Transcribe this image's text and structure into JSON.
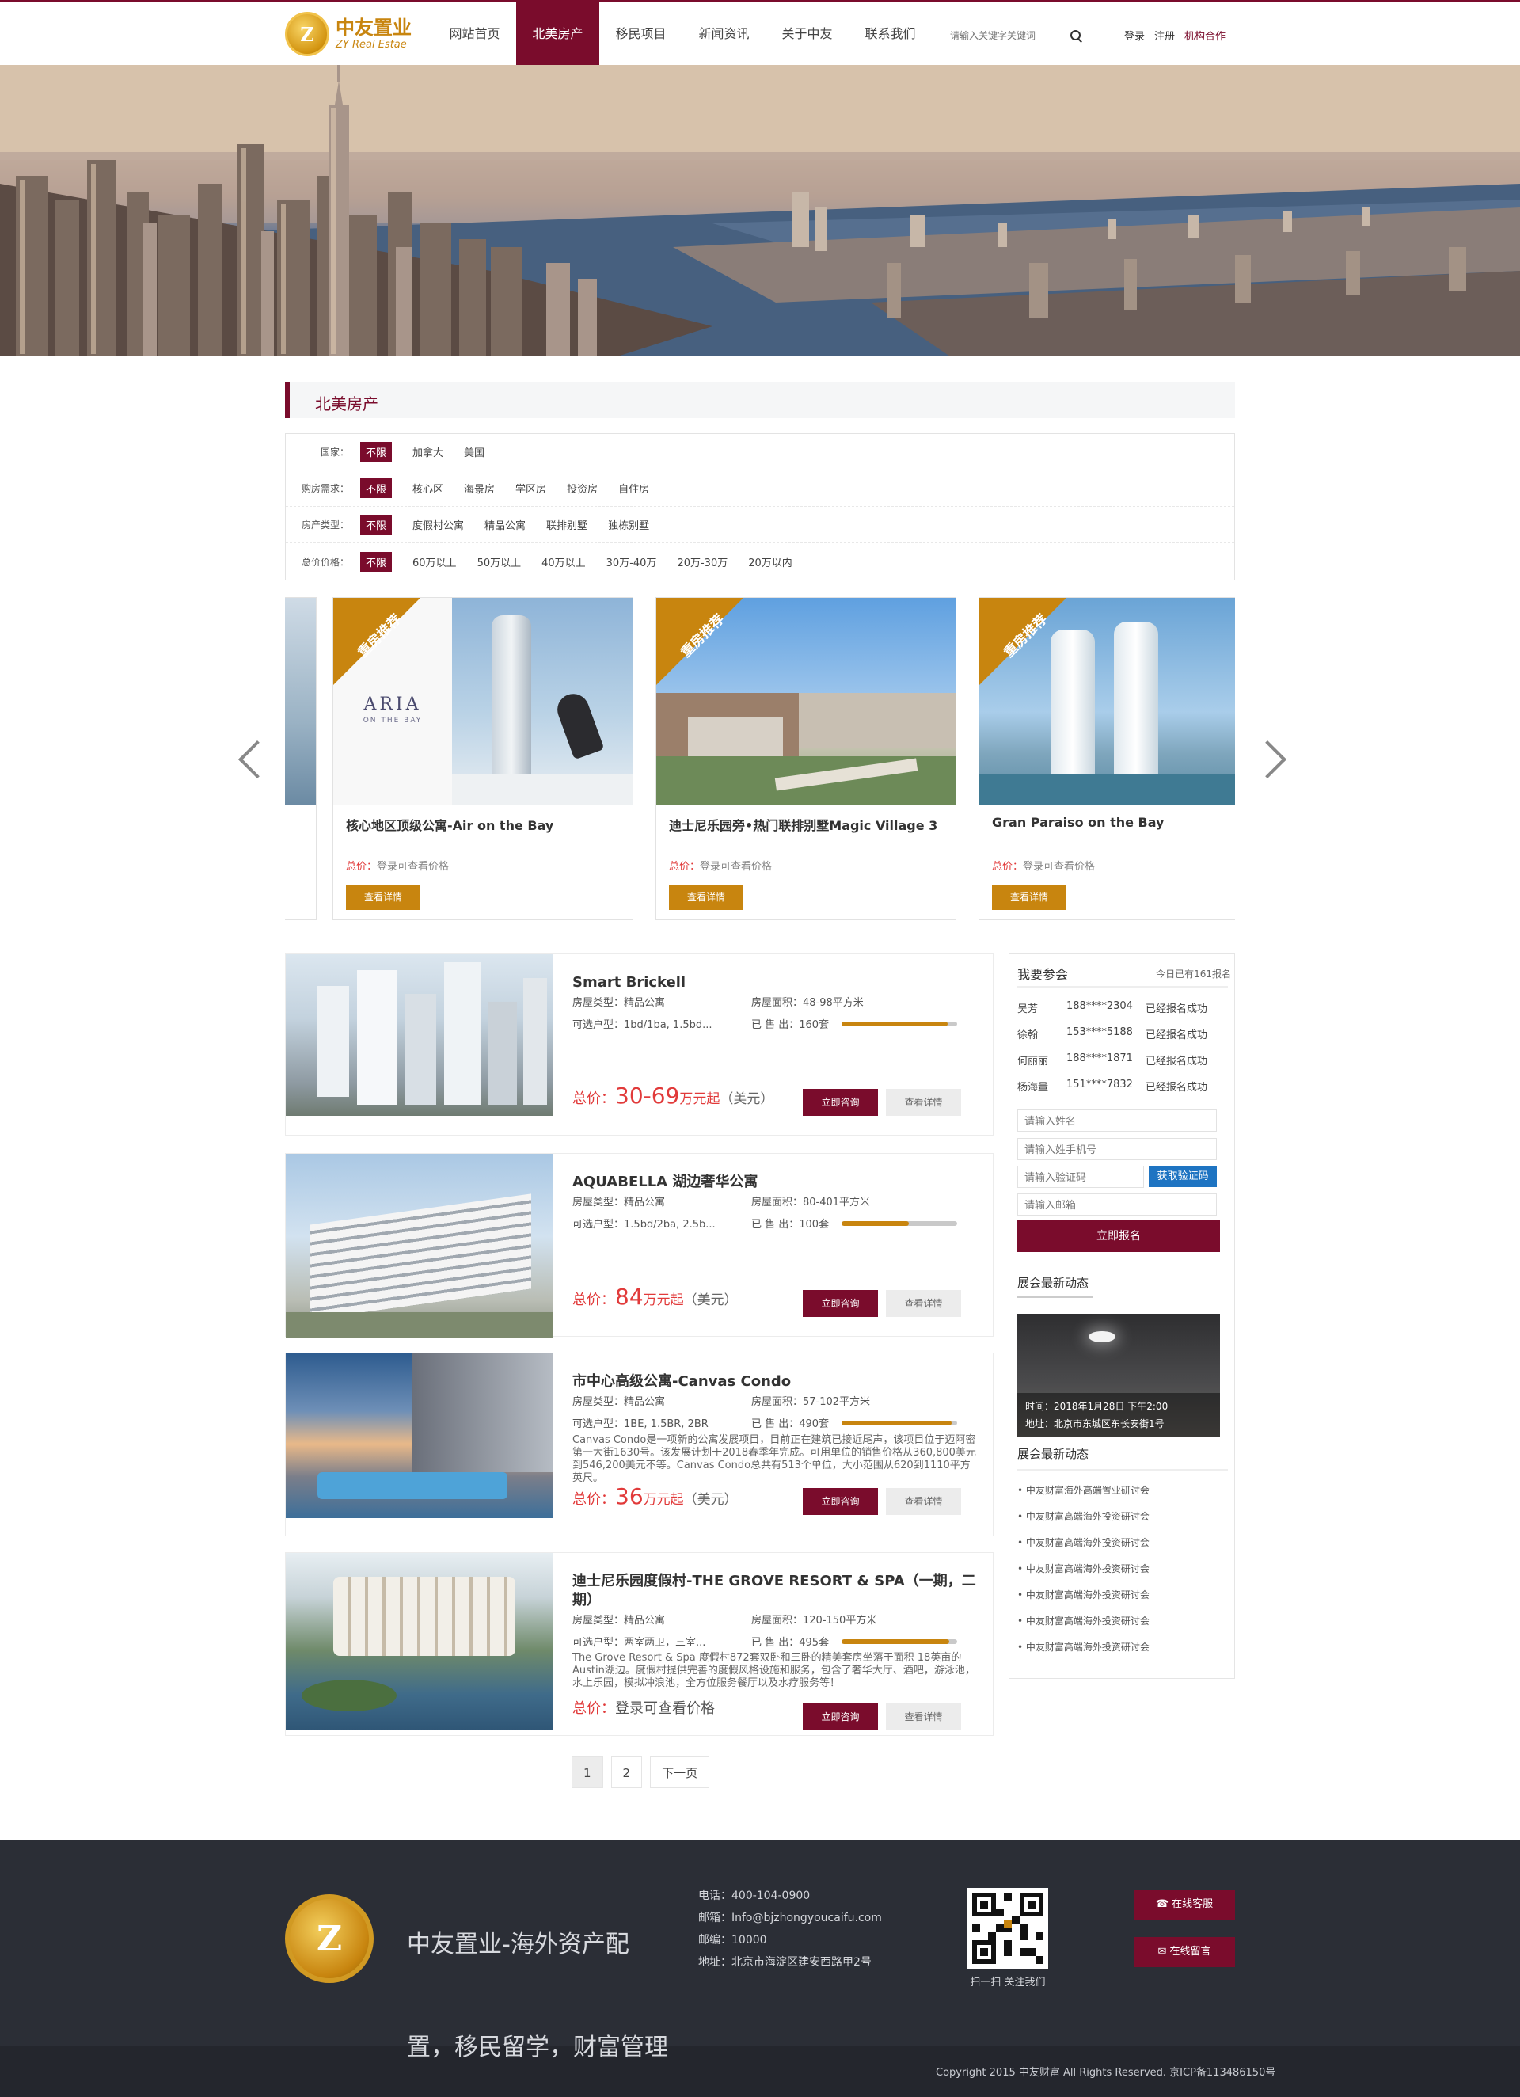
{
  "header": {
    "logo_cn": "中友置业",
    "logo_en": "ZY Real Estae",
    "nav": [
      "网站首页",
      "北美房产",
      "移民项目",
      "新闻资讯",
      "关于中友",
      "联系我们"
    ],
    "active_nav": "北美房产",
    "search_placeholder": "请输入关键字关键词",
    "login": "登录",
    "register": "注册",
    "cooperate": "机构合作"
  },
  "section_title": "北美房产",
  "filters": [
    {
      "label": "国家：",
      "selected": "不限",
      "options": [
        "加拿大",
        "美国"
      ]
    },
    {
      "label": "购房需求：",
      "selected": "不限",
      "options": [
        "核心区",
        "海景房",
        "学区房",
        "投资房",
        "自住房"
      ]
    },
    {
      "label": "房产类型：",
      "selected": "不限",
      "options": [
        "度假村公寓",
        "精品公寓",
        "联排别墅",
        "独栋别墅"
      ]
    },
    {
      "label": "总价价格：",
      "selected": "不限",
      "options": [
        "60万以上",
        "50万以上",
        "40万以上",
        "30万-40万",
        "20万-30万",
        "20万以内"
      ]
    }
  ],
  "carousel": {
    "ribbon": "重房推荐",
    "price_label": "总价：",
    "price_text": "登录可查看价格",
    "button": "查看详情",
    "items": [
      {
        "title": "核心地区顶级公寓-Air on the Bay",
        "brand": "ARIA",
        "brand_sub": "ON THE BAY"
      },
      {
        "title": "迪士尼乐园旁•热门联排别墅Magic Village 3"
      },
      {
        "title": "Gran Paraiso on the Bay"
      }
    ]
  },
  "listing_labels": {
    "type": "房屋类型：",
    "area": "房屋面积：",
    "layout": "可选户型：",
    "sold": "已 售 出：",
    "price": "总价：",
    "consult": "立即咨询",
    "detail": "查看详情"
  },
  "listings": [
    {
      "name": "Smart Brickell",
      "type": "精品公寓",
      "area": "48-98平方米",
      "layout": "1bd/1ba, 1.5bd...",
      "sold": "160套",
      "progress": 0.92,
      "price_num": "30-69",
      "price_unit": "万元起",
      "currency": "（美元）",
      "desc": ""
    },
    {
      "name": "AQUABELLA 湖边奢华公寓",
      "type": "精品公寓",
      "area": "80-401平方米",
      "layout": "1.5bd/2ba, 2.5b...",
      "sold": "100套",
      "progress": 0.58,
      "price_num": "84",
      "price_unit": "万元起",
      "currency": "（美元）",
      "desc": ""
    },
    {
      "name": "市中心高级公寓-Canvas Condo",
      "type": "精品公寓",
      "area": "57-102平方米",
      "layout": "1BE, 1.5BR, 2BR",
      "sold": "490套",
      "progress": 0.95,
      "price_num": "36",
      "price_unit": "万元起",
      "currency": "（美元）",
      "desc": "Canvas Condo是一项新的公寓发展项目，目前正在建筑已接近尾声，该项目位于迈阿密第一大街1630号。该发展计划于2018春季年完成。可用单位的销售价格从360,800美元到546,200美元不等。Canvas Condo总共有513个单位，大小范围从620到1110平方英尺。"
    },
    {
      "name": "迪士尼乐园度假村-THE GROVE RESORT & SPA（一期，二期）",
      "type": "精品公寓",
      "area": "120-150平方米",
      "layout": "两室两卫，三室...",
      "sold": "495套",
      "progress": 0.93,
      "price_num": "",
      "price_unit": "",
      "currency": "",
      "price_text": "登录可查看价格",
      "desc": "The Grove Resort & Spa 度假村872套双卧和三卧的精美套房坐落于面积 18英亩的Austin湖边。度假村提供完善的度假风格设施和服务，包含了奢华大厅、酒吧，游泳池，水上乐园，模拟冲浪池，全方位服务餐厅以及水疗服务等！"
    }
  ],
  "pagination": [
    "1",
    "2",
    "下一页"
  ],
  "sidebar": {
    "signup_title": "我要参会",
    "signup_count": "今日已有161报名",
    "signups": [
      {
        "name": "吴芳",
        "phone": "188****2304",
        "status": "已经报名成功"
      },
      {
        "name": "徐翰",
        "phone": "153****5188",
        "status": "已经报名成功"
      },
      {
        "name": "何丽丽",
        "phone": "188****1871",
        "status": "已经报名成功"
      },
      {
        "name": "杨海量",
        "phone": "151****7832",
        "status": "已经报名成功"
      }
    ],
    "name_placeholder": "请输入姓名",
    "phone_placeholder": "请输入姓手机号",
    "code_placeholder": "请输入验证码",
    "code_button": "获取验证码",
    "email_placeholder": "请输入邮箱",
    "submit": "立即报名",
    "expo_title": "展会最新动态",
    "expo_time": "时间：2018年1月28日 下午2:00",
    "expo_addr": "地址：北京市东城区东长安街1号",
    "news_title": "展会最新动态",
    "news": [
      "中友财富海外高端置业研讨会",
      "中友财富高端海外投资研讨会",
      "中友财富高端海外投资研讨会",
      "中友财富高端海外投资研讨会",
      "中友财富高端海外投资研讨会",
      "中友财富高端海外投资研讨会",
      "中友财富高端海外投资研讨会"
    ]
  },
  "footer": {
    "slogan_line1": "中友置业-海外资产配",
    "slogan_line2": "置，移民留学，财富管理",
    "phone": "电话：400-104-0900",
    "email": "邮箱：Info@bjzhongyoucaifu.com",
    "postcode": "邮编：10000",
    "address": "地址：北京市海淀区建安西路甲2号",
    "qr_caption": "扫一扫 关注我们",
    "service": "在线客服",
    "message": "在线留言",
    "copyright": "Copyright 2015 中友财富 All Rights Reserved. 京ICP备113486150号"
  },
  "colors": {
    "brand": "#7a0c2c",
    "accent": "#c8850f",
    "price": "#e13a3a",
    "footer": "#2b2e36"
  }
}
